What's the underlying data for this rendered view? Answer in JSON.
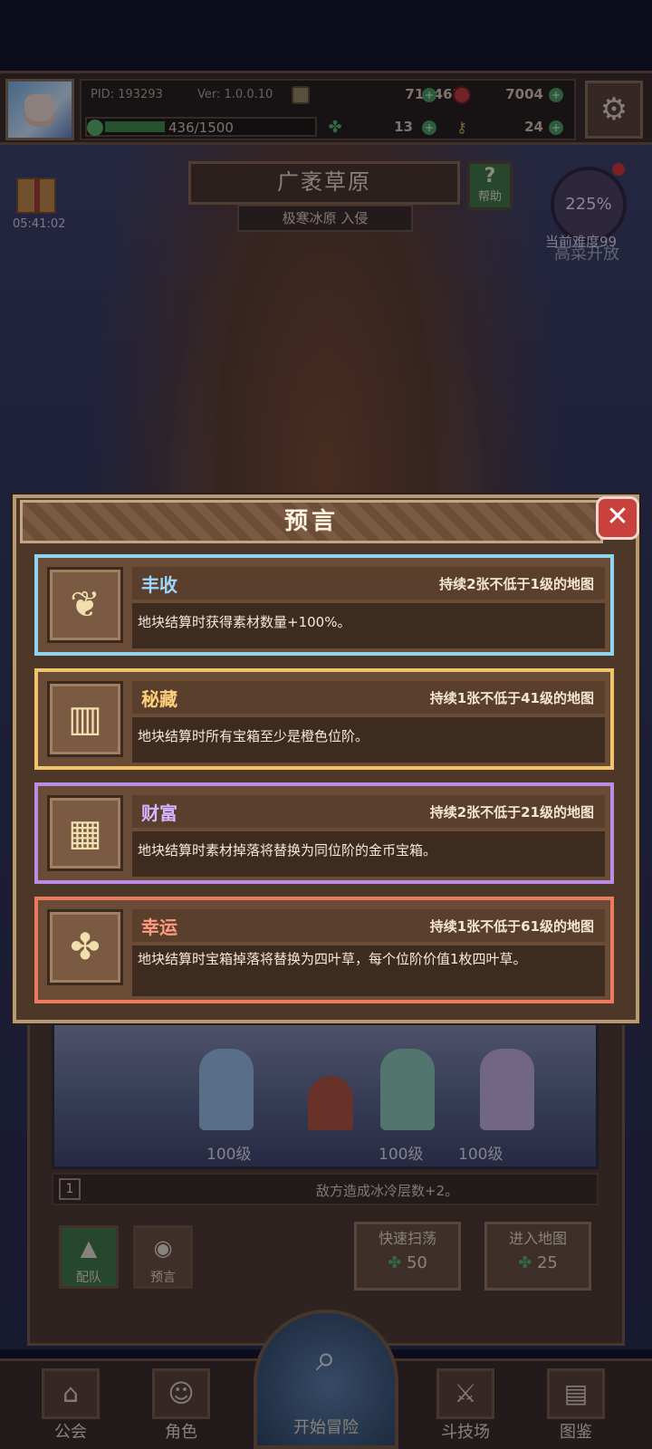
{
  "topbar": {
    "pid": "PID: 193293",
    "version": "Ver: 1.0.0.10",
    "gold": "718461",
    "gems": "7004",
    "energy": "436/1500",
    "energy_fraction": 0.29,
    "clovers": "13",
    "keys": "24"
  },
  "scene": {
    "map_title": "广袤草原",
    "map_subtitle": "极寒冰原 入侵",
    "help_label": "帮助",
    "gift_timer": "05:41:02",
    "difficulty_percent": "225%",
    "difficulty_label": "当前难度99",
    "difficulty_overlay": "高菜开放"
  },
  "modal": {
    "title": "预言",
    "cards": [
      {
        "name": "丰收",
        "duration": "持续2张不低于1级的地图",
        "desc": "地块结算时获得素材数量+100%。",
        "icon": "wheat-icon",
        "border_color": "#8fd3f0",
        "name_color": "#9fd8ff"
      },
      {
        "name": "秘藏",
        "duration": "持续1张不低于41级的地图",
        "desc": "地块结算时所有宝箱至少是橙色位阶。",
        "icon": "scroll-icon",
        "border_color": "#f1c36a",
        "name_color": "#ffcf7a"
      },
      {
        "name": "财富",
        "duration": "持续2张不低于21级的地图",
        "desc": "地块结算时素材掉落将替换为同位阶的金币宝箱。",
        "icon": "coin-stack-icon",
        "border_color": "#b88de6",
        "name_color": "#d6b4ff"
      },
      {
        "name": "幸运",
        "duration": "持续1张不低于61级的地图",
        "desc": "地块结算时宝箱掉落将替换为四叶草，每个位阶价值1枚四叶草。",
        "icon": "clover-icon",
        "border_color": "#ea7b5e",
        "name_color": "#ff9b7e"
      }
    ]
  },
  "lower": {
    "levels": [
      "100级",
      "100级",
      "100级"
    ],
    "skill_num": "1",
    "skill_text": "敌方造成冰冷层数+2。",
    "team_label": "配队",
    "prophecy_label": "预言",
    "quick_sweep_label": "快速扫荡",
    "quick_sweep_cost": "50",
    "enter_map_label": "进入地图",
    "enter_map_cost": "25"
  },
  "nav": {
    "guild": "公会",
    "character": "角色",
    "start": "开始冒险",
    "arena": "斗技场",
    "codex": "图鉴"
  }
}
